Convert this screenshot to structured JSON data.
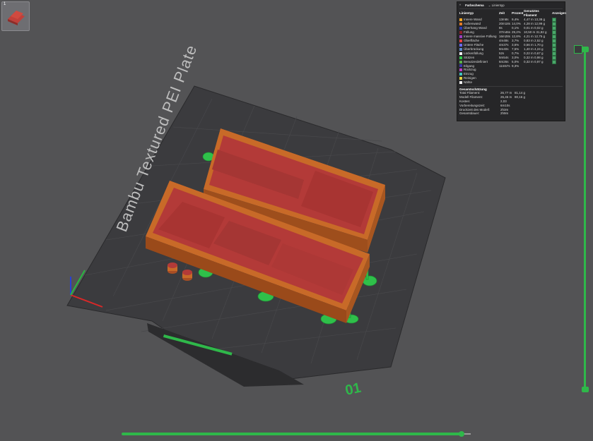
{
  "plate": {
    "name": "Bambu Textured PEI Plate",
    "number": "01",
    "thumbnail_label": "1"
  },
  "legend": {
    "color_scheme_label": "Farbschema",
    "color_scheme_value": "Linientyp",
    "columns": [
      "Linientyp",
      "Zeit",
      "Prozent",
      "Genutztes Filament",
      "Anzeigen"
    ],
    "rows": [
      {
        "name": "Innere Wand",
        "color": "#f5a623",
        "time": "13m8s",
        "percent": "9,4%",
        "length": "4,47 m",
        "weight": "13,38 g"
      },
      {
        "name": "Außenwand",
        "color": "#e27a2a",
        "time": "20m18s",
        "percent": "14,0%",
        "length": "4,28 m",
        "weight": "12,99 g"
      },
      {
        "name": "Überhang Wand",
        "color": "#2d3bb5",
        "time": "8s",
        "percent": "0,1%",
        "length": "0,01 m",
        "weight": "0,02 g"
      },
      {
        "name": "Füllung",
        "color": "#8b1e2a",
        "time": "37m46s",
        "percent": "29,2%",
        "length": "10,50 m",
        "weight": "31,82 g"
      },
      {
        "name": "Innere massive Füllung",
        "color": "#9b3fbf",
        "time": "16m28s",
        "percent": "12,8%",
        "length": "4,21 m",
        "weight": "12,75 g"
      },
      {
        "name": "Oberfläche",
        "color": "#e84040",
        "time": "4m48s",
        "percent": "3,7%",
        "length": "0,83 m",
        "weight": "2,52 g"
      },
      {
        "name": "Untere Fläche",
        "color": "#6a6aff",
        "time": "4m37s",
        "percent": "3,6%",
        "length": "0,56 m",
        "weight": "1,70 g"
      },
      {
        "name": "Überbrückung",
        "color": "#5a88c8",
        "time": "9m40s",
        "percent": "7,5%",
        "length": "1,40 m",
        "weight": "4,24 g"
      },
      {
        "name": "Lückenfüllung",
        "color": "#f0f0f0",
        "time": "52s",
        "percent": "0,7%",
        "length": "0,22 m",
        "weight": "0,67 g"
      },
      {
        "name": "Stützen",
        "color": "#2ec84a",
        "time": "5m54s",
        "percent": "3,0%",
        "length": "0,32 m",
        "weight": "0,98 g"
      },
      {
        "name": "Benutzerdefiniert",
        "color": "#5ab04a",
        "time": "6m26s",
        "percent": "5,0%",
        "length": "0,32 m",
        "weight": "0,97 g"
      },
      {
        "name": "Eilgang",
        "color": "#3a3aaa",
        "time": "11m57s",
        "percent": "9,3%",
        "length": "",
        "weight": ""
      },
      {
        "name": "Rückzug",
        "color": "#c040c0",
        "time": "",
        "percent": "",
        "length": "",
        "weight": ""
      },
      {
        "name": "Einzug",
        "color": "#40c0c0",
        "time": "",
        "percent": "",
        "length": "",
        "weight": ""
      },
      {
        "name": "Reinigen",
        "color": "#e0d040",
        "time": "",
        "percent": "",
        "length": "",
        "weight": ""
      },
      {
        "name": "Nähte",
        "color": "#f0f0f0",
        "time": "",
        "percent": "",
        "length": "",
        "weight": ""
      }
    ],
    "estimate_title": "Gesamtschätzung",
    "estimates": [
      {
        "label": "Total Filament:",
        "v1": "26,77 m",
        "v2": "81,14 g"
      },
      {
        "label": "Modell Filament:",
        "v1": "26,45 m",
        "v2": "80,16 g"
      },
      {
        "label": "Kosten:",
        "v1": "2,03",
        "v2": ""
      },
      {
        "label": "Vorbereitungszeit:",
        "v1": "6m10s",
        "v2": ""
      },
      {
        "label": "Druckzeit des Modell:",
        "v1": "2h3m",
        "v2": ""
      },
      {
        "label": "Gesamtdauer:",
        "v1": "2h9m",
        "v2": ""
      }
    ]
  },
  "colors": {
    "background": "#535355",
    "bed": "#3a3a3c",
    "model_wall": "#c86a28",
    "model_fill": "#b33a38",
    "support": "#2fc04a",
    "slider": "#2fb84a"
  },
  "sliders": {
    "layer_slider": "vertical",
    "move_slider": "horizontal"
  }
}
